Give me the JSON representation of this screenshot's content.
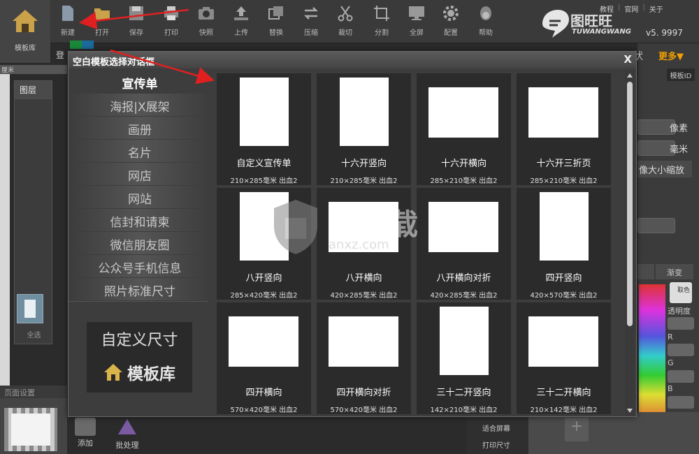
{
  "toolbar": {
    "home_label": "模板库",
    "buttons": [
      "新建",
      "打开",
      "保存",
      "打印",
      "快照",
      "上传",
      "替换",
      "压缩",
      "裁切",
      "分割",
      "全屏",
      "配置",
      "帮助"
    ],
    "links": [
      "教程",
      "官网",
      "关于"
    ],
    "logo_text": "图旺旺",
    "logo_sub": "TUWANGWANG",
    "version": "v5. 9997"
  },
  "background": {
    "login": "登",
    "ruler_unit": "厘米",
    "layer_title": "图层",
    "select_all": "全选",
    "page_setting": "页面设置",
    "bottom_add": "添加",
    "bottom_batch": "批处理",
    "right_more": "更多▼",
    "right_state": "状",
    "template_id": "模板ID",
    "unit_px": "像素",
    "unit_mm": "毫米",
    "scale_btn": "像大小缩放",
    "tab_gradient": "渐变",
    "eyedrop": "取色",
    "opacity": "透明度",
    "r": "R",
    "g": "G",
    "b": "B",
    "fit_screen": "适合屏幕",
    "print_size": "打印尺寸"
  },
  "dialog": {
    "title": "空白模板选择对话框",
    "close": "X",
    "categories": [
      "宣传单",
      "海报|X展架",
      "画册",
      "名片",
      "网店",
      "网站",
      "信封和请柬",
      "微信朋友圈",
      "公众号手机信息",
      "照片标准尺寸"
    ],
    "active_category": 0,
    "custom_size": "自定义尺寸",
    "template_lib": "模板库",
    "cards": [
      {
        "name": "自定义宣传单",
        "size": "210×285毫米 出血2",
        "orient": "portrait"
      },
      {
        "name": "十六开竖向",
        "size": "210×285毫米 出血2",
        "orient": "portrait"
      },
      {
        "name": "十六开横向",
        "size": "285×210毫米 出血2",
        "orient": "landscape"
      },
      {
        "name": "十六开三折页",
        "size": "285×210毫米 出血2",
        "orient": "landscape"
      },
      {
        "name": "八开竖向",
        "size": "285×420毫米 出血2",
        "orient": "portrait"
      },
      {
        "name": "八开横向",
        "size": "420×285毫米 出血2",
        "orient": "landscape"
      },
      {
        "name": "八开横向对折",
        "size": "420×285毫米 出血2",
        "orient": "landscape"
      },
      {
        "name": "四开竖向",
        "size": "420×570毫米 出血2",
        "orient": "portrait"
      },
      {
        "name": "四开横向",
        "size": "570×420毫米 出血2",
        "orient": "landscape"
      },
      {
        "name": "四开横向对折",
        "size": "570×420毫米 出血2",
        "orient": "landscape"
      },
      {
        "name": "三十二开竖向",
        "size": "142×210毫米 出血2",
        "orient": "portrait"
      },
      {
        "name": "三十二开横向",
        "size": "210×142毫米 出血2",
        "orient": "landscape"
      }
    ]
  },
  "watermark": {
    "text": "安下载",
    "url": "anxz.com"
  },
  "colors": {
    "accent_orange": "#f0a000",
    "annotation_red": "#e02020"
  }
}
